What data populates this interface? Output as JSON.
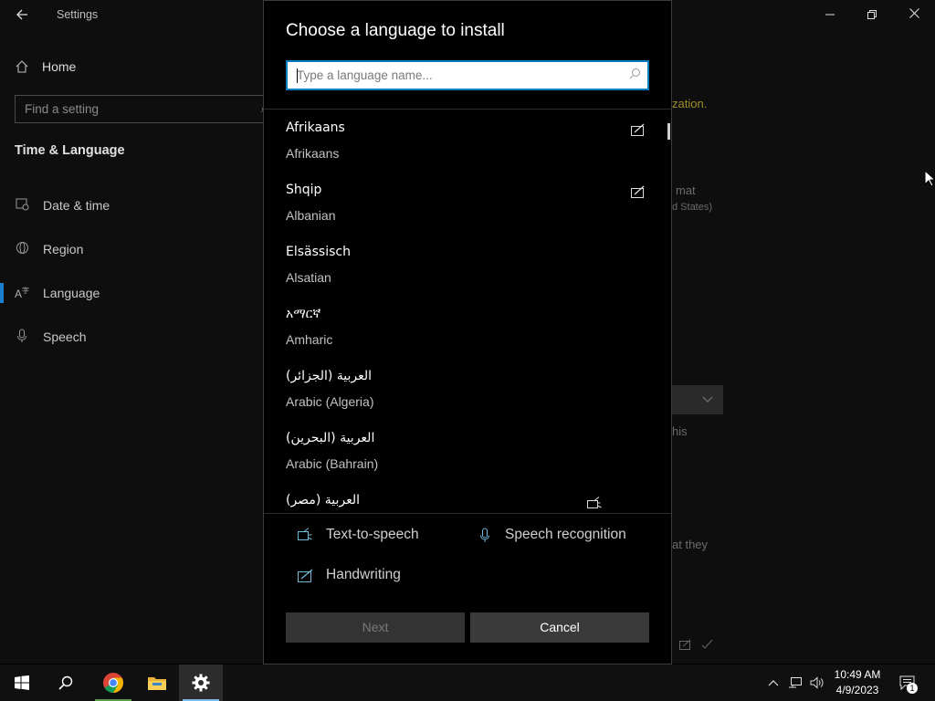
{
  "window": {
    "title": "Settings",
    "controls": {
      "minimize": "—",
      "maximize": "❐",
      "close": "✕"
    }
  },
  "nav": {
    "home": "Home",
    "search_placeholder": "Find a setting",
    "section": "Time & Language",
    "items": [
      {
        "label": "Date & time",
        "icon": "calendar-clock-icon"
      },
      {
        "label": "Region",
        "icon": "globe-icon"
      },
      {
        "label": "Language",
        "icon": "language-icon"
      },
      {
        "label": "Speech",
        "icon": "microphone-icon"
      }
    ]
  },
  "background": {
    "frag1": "zation.",
    "frag2": "mat",
    "frag3": "d States)",
    "frag4": "his",
    "frag5": "at they"
  },
  "dialog": {
    "title": "Choose a language to install",
    "search_placeholder": "Type a language name...",
    "languages": [
      {
        "native": "Afrikaans",
        "english": "Afrikaans",
        "feature_icon": "handwriting-icon"
      },
      {
        "native": "Shqip",
        "english": "Albanian",
        "feature_icon": "handwriting-icon"
      },
      {
        "native": "Elsässisch",
        "english": "Alsatian",
        "feature_icon": ""
      },
      {
        "native": "አማርኛ",
        "english": "Amharic",
        "feature_icon": ""
      },
      {
        "native": "العربية (الجزائر)",
        "english": "Arabic (Algeria)",
        "feature_icon": ""
      },
      {
        "native": "العربية (البحرين)",
        "english": "Arabic (Bahrain)",
        "feature_icon": ""
      },
      {
        "native": "العربية (مصر)",
        "english": "",
        "feature_icon": "text-to-speech-icon"
      }
    ],
    "features": {
      "tts": "Text-to-speech",
      "speech": "Speech recognition",
      "handwriting": "Handwriting"
    },
    "buttons": {
      "next": "Next",
      "cancel": "Cancel"
    }
  },
  "taskbar": {
    "apps": [
      "start-icon",
      "search-icon",
      "chrome-icon",
      "file-explorer-icon",
      "settings-icon"
    ],
    "time": "10:49 AM",
    "date": "4/9/2023",
    "notification_count": "1"
  },
  "colors": {
    "accent": "#0a7cc2",
    "nav_active": "#1b7fcf",
    "feature_icon": "#6fb8d8"
  }
}
